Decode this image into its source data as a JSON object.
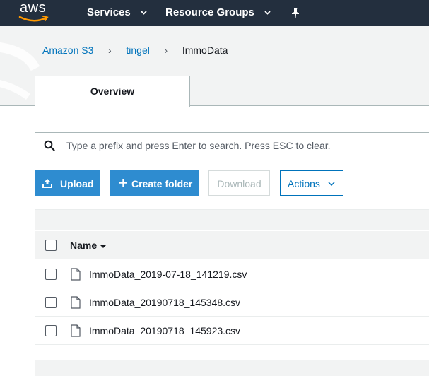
{
  "topnav": {
    "logo_text": "aws",
    "services_label": "Services",
    "resource_groups_label": "Resource Groups",
    "bg_color": "#232f3e"
  },
  "breadcrumb": {
    "items": [
      "Amazon S3",
      "tingel",
      "ImmoData"
    ]
  },
  "tabs": [
    {
      "label": "Overview",
      "active": true
    }
  ],
  "search": {
    "placeholder": "Type a prefix and press Enter to search. Press ESC to clear.",
    "value": ""
  },
  "toolbar": {
    "upload_label": "Upload",
    "create_folder_label": "Create folder",
    "download_label": "Download",
    "actions_label": "Actions"
  },
  "table": {
    "columns": [
      "Name"
    ],
    "rows": [
      {
        "name": "ImmoData_2019-07-18_141219.csv"
      },
      {
        "name": "ImmoData_20190718_145348.csv"
      },
      {
        "name": "ImmoData_20190718_145923.csv"
      }
    ]
  },
  "colors": {
    "accent": "#0073bb",
    "primary_button": "#2e8cd0",
    "brand_orange": "#ff9900"
  }
}
